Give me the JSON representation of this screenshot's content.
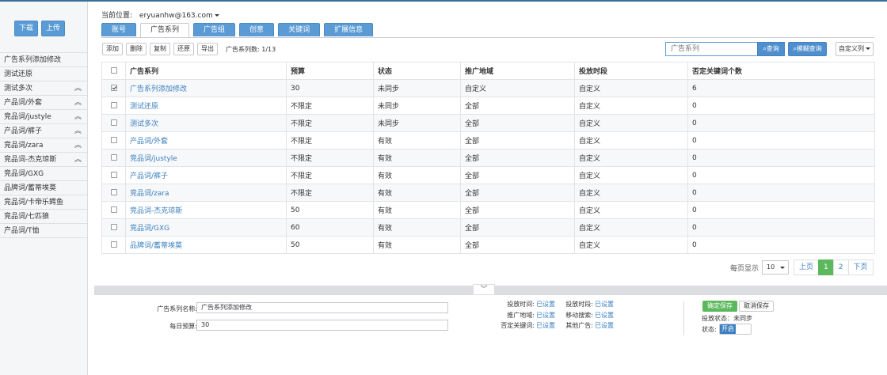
{
  "sidebar": {
    "download_label": "下载",
    "upload_label": "上传",
    "items": [
      {
        "label": "广告系列添加修改",
        "chevron": ""
      },
      {
        "label": "测试还原",
        "chevron": ""
      },
      {
        "label": "测试多次",
        "chevron": "︽"
      },
      {
        "label": "产品词/外套",
        "chevron": "︽"
      },
      {
        "label": "竞品词/justyle",
        "chevron": "︽"
      },
      {
        "label": "产品词/裤子",
        "chevron": "︽"
      },
      {
        "label": "竞品词/zara",
        "chevron": "︽"
      },
      {
        "label": "竞品词-杰克琼斯",
        "chevron": "︽"
      },
      {
        "label": "竞品词/GXG",
        "chevron": ""
      },
      {
        "label": "品牌词/蓄蒂埃莫",
        "chevron": ""
      },
      {
        "label": "竞品词/卡帝乐鳄鱼",
        "chevron": ""
      },
      {
        "label": "竞品词/七匹狼",
        "chevron": ""
      },
      {
        "label": "产品词/T恤",
        "chevron": ""
      }
    ]
  },
  "header": {
    "location_label": "当前位置:",
    "account": "eryuanhw@163.com"
  },
  "tabs": [
    {
      "label": "账号",
      "active": false
    },
    {
      "label": "广告系列",
      "active": true
    },
    {
      "label": "广告组",
      "active": false
    },
    {
      "label": "创意",
      "active": false
    },
    {
      "label": "关键词",
      "active": false
    },
    {
      "label": "扩展信息",
      "active": false
    }
  ],
  "toolbar": {
    "add_label": "添加",
    "delete_label": "删除",
    "copy_label": "复制",
    "restore_label": "还原",
    "export_label": "导出",
    "count_text": "广告系列数: 1/13"
  },
  "search": {
    "placeholder": "广告系列",
    "query_label": "查询",
    "advanced_label": "模糊查询",
    "custom_label": "自定义列"
  },
  "table": {
    "headers": [
      "广告系列",
      "预算",
      "状态",
      "推广地域",
      "投放时段",
      "否定关键词个数"
    ],
    "rows": [
      {
        "checked": true,
        "name": "广告系列添加修改",
        "budget": "30",
        "status": "未同步",
        "region": "自定义",
        "schedule": "自定义",
        "neg": "6"
      },
      {
        "checked": false,
        "name": "测试还原",
        "budget": "不限定",
        "status": "未同步",
        "region": "全部",
        "schedule": "自定义",
        "neg": "0"
      },
      {
        "checked": false,
        "name": "测试多次",
        "budget": "不限定",
        "status": "未同步",
        "region": "全部",
        "schedule": "自定义",
        "neg": "0"
      },
      {
        "checked": false,
        "name": "产品词/外套",
        "budget": "不限定",
        "status": "有效",
        "region": "全部",
        "schedule": "自定义",
        "neg": "0"
      },
      {
        "checked": false,
        "name": "竞品词/justyle",
        "budget": "不限定",
        "status": "有效",
        "region": "全部",
        "schedule": "自定义",
        "neg": "0"
      },
      {
        "checked": false,
        "name": "产品词/裤子",
        "budget": "不限定",
        "status": "有效",
        "region": "全部",
        "schedule": "自定义",
        "neg": "0"
      },
      {
        "checked": false,
        "name": "竞品词/zara",
        "budget": "不限定",
        "status": "有效",
        "region": "全部",
        "schedule": "自定义",
        "neg": "0"
      },
      {
        "checked": false,
        "name": "竞品词-杰克琼斯",
        "budget": "50",
        "status": "有效",
        "region": "全部",
        "schedule": "自定义",
        "neg": "0"
      },
      {
        "checked": false,
        "name": "竞品词/GXG",
        "budget": "60",
        "status": "有效",
        "region": "全部",
        "schedule": "自定义",
        "neg": "0"
      },
      {
        "checked": false,
        "name": "品牌词/蓄蒂埃莫",
        "budget": "50",
        "status": "有效",
        "region": "全部",
        "schedule": "自定义",
        "neg": "0"
      }
    ]
  },
  "pager": {
    "per_page_label": "每页显示",
    "per_page_value": "10",
    "prev_label": "上页",
    "pages": [
      "1",
      "2"
    ],
    "next_label": "下页"
  },
  "divider": {
    "toggle_glyph": "︾"
  },
  "details": {
    "name_label": "广告系列名称:",
    "name_value": "广告系列添加修改",
    "budget_label": "每日预算:",
    "budget_value": "30",
    "settings": {
      "time_label": "投放时间:",
      "time_value": "已设置",
      "slot_label": "投放时段:",
      "slot_value": "已设置",
      "region_label": "推广地域:",
      "region_value": "已设置",
      "mobile_label": "移动搜索:",
      "mobile_value": "已设置",
      "neg_label": "否定关键词:",
      "neg_value": "已设置",
      "other_label": "其他广告:",
      "other_value": "已设置"
    },
    "save_label": "确定保存",
    "cancel_label": "取消保存",
    "sync_status": "投放状态：未同步",
    "state_label": "状态:",
    "toggle_on": "开启"
  }
}
